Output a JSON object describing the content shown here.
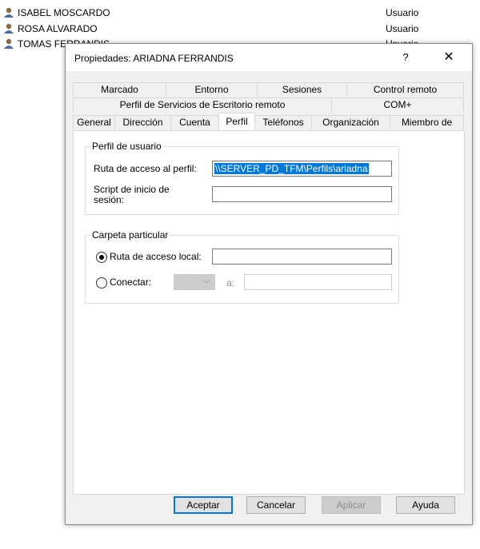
{
  "background_list": [
    {
      "name": "ISABEL MOSCARDO",
      "type": "Usuario"
    },
    {
      "name": "ROSA ALVARADO",
      "type": "Usuario"
    },
    {
      "name": "TOMAS FERRANDIS",
      "type": "Usuario"
    }
  ],
  "dialog": {
    "title": "Propiedades: ARIADNA FERRANDIS",
    "help_label": "?",
    "close_label": "✕",
    "tabs_row1": [
      "Marcado",
      "Entorno",
      "Sesiones",
      "Control remoto"
    ],
    "tabs_row2": [
      "Perfil de Servicios de Escritorio remoto",
      "COM+"
    ],
    "tabs_row3": [
      "General",
      "Dirección",
      "Cuenta",
      "Perfil",
      "Teléfonos",
      "Organización",
      "Miembro de"
    ],
    "active_tab": "Perfil",
    "profile_group": {
      "label": "Perfil de usuario",
      "path_label": "Ruta de acceso al perfil:",
      "path_value": "\\\\SERVER_PD_TFM\\Perfils\\ariadna",
      "script_label": "Script de inicio de sesión:",
      "script_value": ""
    },
    "home_group": {
      "label": "Carpeta particular",
      "local_label": "Ruta de acceso local:",
      "local_value": "",
      "connect_label": "Conectar:",
      "to_label": "a:",
      "connect_value": ""
    },
    "buttons": {
      "ok": "Aceptar",
      "cancel": "Cancelar",
      "apply": "Aplicar",
      "help": "Ayuda"
    }
  },
  "colors": {
    "accent": "#0078d7",
    "dialog_bg": "#f0f0f0"
  }
}
